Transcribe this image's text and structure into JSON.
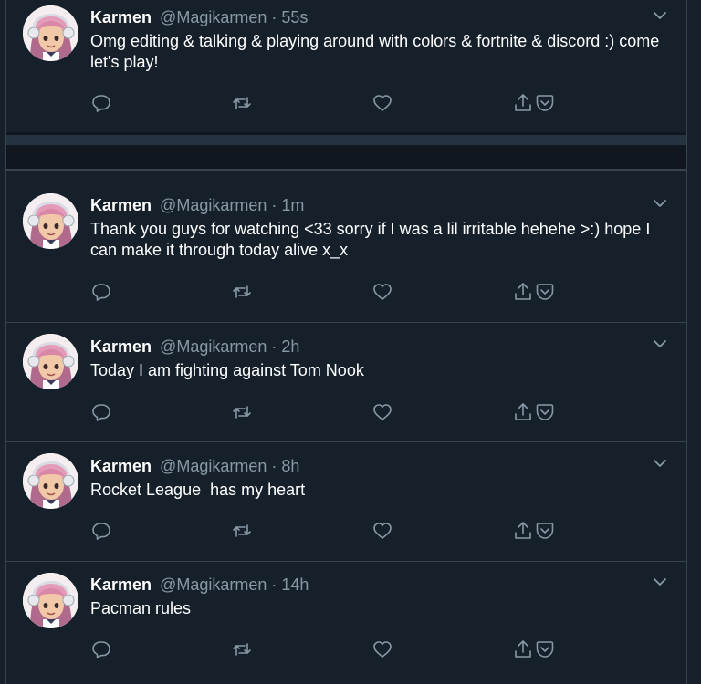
{
  "colors": {
    "background": "#15202b",
    "separator": "#10171e",
    "border": "#38444d",
    "secondary_text": "#8899a6",
    "primary_text": "#ffffff"
  },
  "icons": {
    "reply": "reply-icon",
    "retweet": "retweet-icon",
    "like": "like-icon",
    "share": "share-icon",
    "save": "save-icon",
    "more": "chevron-down-icon"
  },
  "tweets": [
    {
      "name": "Karmen",
      "handle": "@Magikarmen",
      "separator": "·",
      "time": "55s",
      "text": "Omg editing & talking & playing around with colors & fortnite & discord :) come let's play!"
    },
    {
      "name": "Karmen",
      "handle": "@Magikarmen",
      "separator": "·",
      "time": "1m",
      "text": "Thank you guys for watching <33 sorry if I was a lil irritable hehehe >:) hope I can make it through today alive x_x"
    },
    {
      "name": "Karmen",
      "handle": "@Magikarmen",
      "separator": "·",
      "time": "2h",
      "text": "Today I am fighting against Tom Nook"
    },
    {
      "name": "Karmen",
      "handle": "@Magikarmen",
      "separator": "·",
      "time": "8h",
      "text": "Rocket League  has my heart"
    },
    {
      "name": "Karmen",
      "handle": "@Magikarmen",
      "separator": "·",
      "time": "14h",
      "text": "Pacman rules"
    }
  ]
}
